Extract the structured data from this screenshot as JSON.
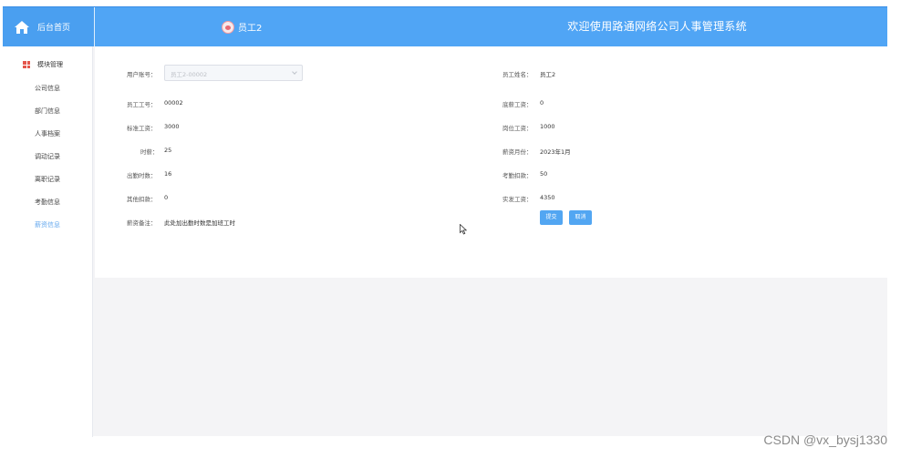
{
  "header": {
    "home_label": "后台首页",
    "user_name": "员工2",
    "site_title": "欢迎使用路通网络公司人事管理系统"
  },
  "sidebar": {
    "section_label": "模块管理",
    "items": [
      {
        "label": "公司信息"
      },
      {
        "label": "部门信息"
      },
      {
        "label": "人事档案"
      },
      {
        "label": "调动记录"
      },
      {
        "label": "离职记录"
      },
      {
        "label": "考勤信息"
      },
      {
        "label": "薪资信息",
        "active": true
      }
    ]
  },
  "form": {
    "account_label": "用户账号：",
    "account_value": "员工2-00002",
    "staff_name_label": "员工姓名：",
    "staff_name_value": "员工2",
    "staff_no_label": "员工工号：",
    "staff_no_value": "00002",
    "base_salary_label": "底薪工资：",
    "base_salary_value": "0",
    "std_salary_label": "标准工资：",
    "std_salary_value": "3000",
    "post_salary_label": "岗位工资：",
    "post_salary_value": "1000",
    "hours_label": "时薪：",
    "hours_value": "25",
    "salary_month_label": "薪资月份：",
    "salary_month_value": "2023年1月",
    "attendance_hours_label": "出勤时数：",
    "attendance_hours_value": "16",
    "attendance_deduct_label": "考勤扣款：",
    "attendance_deduct_value": "50",
    "other_deduct_label": "其他扣款：",
    "other_deduct_value": "0",
    "net_salary_label": "实发工资：",
    "net_salary_value": "4350",
    "remark_label": "薪资备注：",
    "remark_value": "此处加出勤时数是加班工时",
    "submit_label": "提交",
    "cancel_label": "取消"
  },
  "watermark": "CSDN @vx_bysj1330"
}
